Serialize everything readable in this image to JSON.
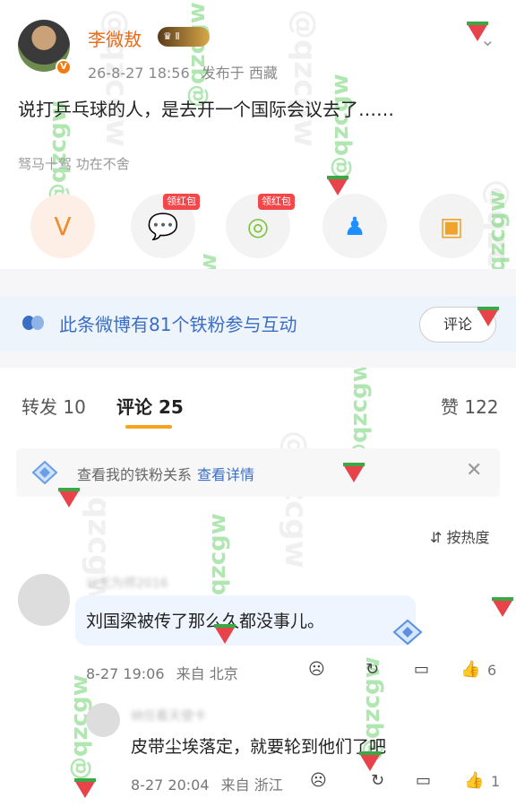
{
  "post": {
    "author": "李微敖",
    "level": "Ⅱ",
    "time": "26-8-27 18:56",
    "location": "发布于 西藏",
    "text": "说打乒乓球的人，是去开一个国际会议去了……",
    "device": "驽马十驾 功在不舍"
  },
  "share": {
    "redtag": "领红包"
  },
  "fans_banner": {
    "text": "此条微博有81个铁粉参与互动",
    "comment_button": "评论"
  },
  "tabs": {
    "repost": "转发 10",
    "comments": "评论 25",
    "likes": "赞 122"
  },
  "relation": {
    "text": "查看我的铁粉关系",
    "link": "查看详情"
  },
  "sort_label": "按热度",
  "comments": [
    {
      "name": "以无为师2016",
      "text": "刘国梁被传了那么久都没事儿。",
      "time": "8-27 19:06",
      "location": "来自 北京",
      "likes": "6"
    },
    {
      "name": "纳任看天使卡",
      "text": "皮带尘埃落定，就要轮到他们了吧",
      "time": "8-27 20:04",
      "location": "来自 浙江",
      "likes": "1"
    }
  ],
  "watermark": "@qzcgw",
  "colors": {
    "username": "#e86a1a",
    "link": "#3a6ec4",
    "tab_underline": "#f7a31b",
    "red_tag": "#f4474a"
  }
}
